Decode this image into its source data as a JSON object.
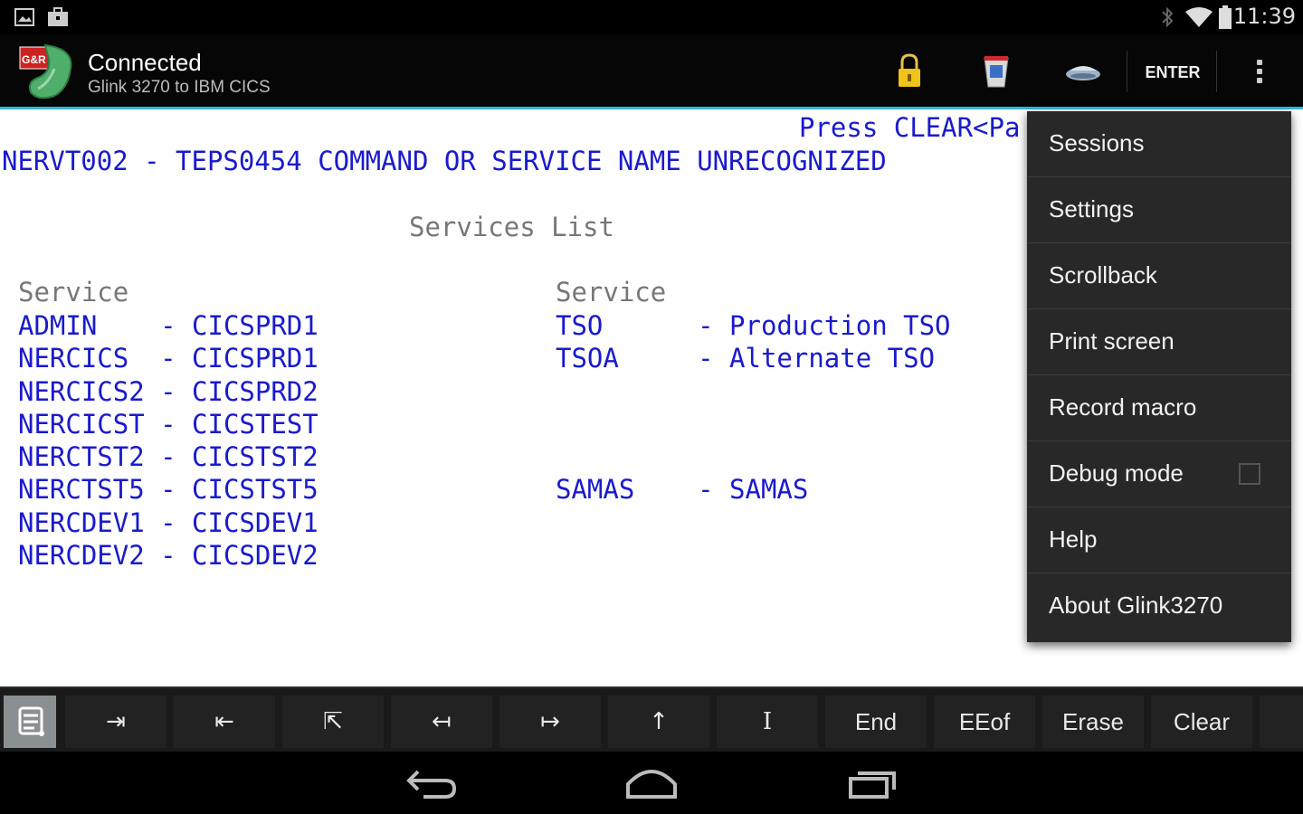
{
  "status_bar": {
    "time": "11:39"
  },
  "action_bar": {
    "title": "Connected",
    "subtitle": "Glink 3270 to IBM CICS",
    "enter_label": "ENTER"
  },
  "terminal": {
    "press_clear": "Press CLEAR<Pa",
    "error_line": "NERVT002 - TEPS0454 COMMAND OR SERVICE NAME UNRECOGNIZED",
    "heading": "Services List",
    "col1_header": "Service",
    "col2_header": "Service",
    "left_rows": [
      "ADMIN    - CICSPRD1",
      "NERCICS  - CICSPRD1",
      "NERCICS2 - CICSPRD2",
      "NERCICST - CICSTEST",
      "NERCTST2 - CICSTST2",
      "NERCTST5 - CICSTST5",
      "NERCDEV1 - CICSDEV1",
      "NERCDEV2 - CICSDEV2"
    ],
    "right_rows": [
      "TSO      - Production TSO",
      "TSOA     - Alternate TSO",
      "SAMAS    - SAMAS"
    ]
  },
  "menu": {
    "items": [
      "Sessions",
      "Settings",
      "Scrollback",
      "Print screen",
      "Record macro",
      "Debug mode",
      "Help",
      "About Glink3270"
    ],
    "debug_mode_checked": false
  },
  "keys": {
    "tab": "⇥",
    "backtab": "⇤",
    "home": "⇱",
    "left": "↤",
    "right": "↦",
    "up": "↑",
    "cursor": "I",
    "end": "End",
    "eeof": "EEof",
    "erase": "Erase",
    "clear": "Clear"
  },
  "colors": {
    "terminal_text": "#1a1acd",
    "accent": "#33b5e5"
  }
}
